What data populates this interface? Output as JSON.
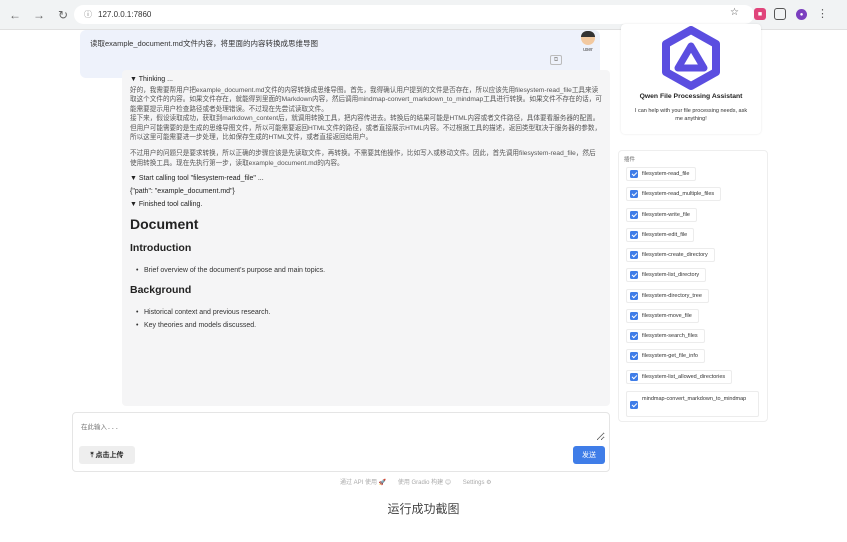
{
  "browser": {
    "url": "127.0.0.1:7860"
  },
  "chat": {
    "user_message": "读取example_document.md文件内容，将里面的内容转换成思维导图",
    "user_label": "user",
    "thinking_title": "▼ Thinking ...",
    "thinking_paragraphs": [
      "好的，我需要帮用户把example_document.md文件的内容转换成思维导图。首先，我得确认用户提到的文件是否存在，所以应该先用filesystem-read_file工具来读取这个文件的内容。如果文件存在，就能得到里面的Markdown内容，然后调用mindmap-convert_markdown_to_mindmap工具进行转换。如果文件不存在的话，可能需要提示用户检查路径或者处理错误。不过现在先尝试读取文件。",
      "接下来，假设读取成功，获取到markdown_content后，就调用转换工具，把内容传进去。转换后的结果可能是HTML内容或者文件路径，具体要看服务器的配置。但用户可能需要的是生成的思维导图文件，所以可能需要返回HTML文件的路径，或者直接展示HTML内容。不过根据工具的描述，返回类型取决于服务器的参数，所以这里可能需要进一步处理，比如保存生成的HTML文件，或者直接返回给用户。",
      "不过用户的问题只是要求转换，所以正确的步骤应该是先读取文件，再转换。不需要其他操作，比如写入或移动文件。因此，首先调用filesystem-read_file，然后使用转换工具。现在先执行第一步，读取example_document.md的内容。"
    ],
    "tool_call": "▼ Start calling tool \"filesystem-read_file\" ...",
    "tool_args": "{\"path\": \"example_document.md\"}",
    "tool_finished": "▼ Finished tool calling.",
    "doc_title": "Document",
    "sections": [
      {
        "heading": "Introduction",
        "items": [
          "Brief overview of the document's purpose and main topics."
        ]
      },
      {
        "heading": "Background",
        "items": [
          "Historical context and previous research.",
          "Key theories and models discussed."
        ]
      }
    ]
  },
  "input": {
    "placeholder": "在此输入...",
    "upload_label": "⤒ 点击上传",
    "send_label": "发送"
  },
  "footer": {
    "api": "通过 API 使用 🚀",
    "gradio": "使用 Gradio 构建 😊",
    "settings": "Settings ⚙"
  },
  "caption": "运行成功截图",
  "assistant": {
    "title": "Qwen File Processing Assistant",
    "description": "I can help with your file processing needs, ask me anything!",
    "logo_color": "#5b4ee0"
  },
  "plugins": {
    "label": "插件",
    "items": [
      "filesystem-read_file",
      "filesystem-read_multiple_files",
      "filesystem-write_file",
      "filesystem-edit_file",
      "filesystem-create_directory",
      "filesystem-list_directory",
      "filesystem-directory_tree",
      "filesystem-move_file",
      "filesystem-search_files",
      "filesystem-get_file_info",
      "filesystem-list_allowed_directories",
      "mindmap-convert_markdown_to_mindmap"
    ]
  }
}
